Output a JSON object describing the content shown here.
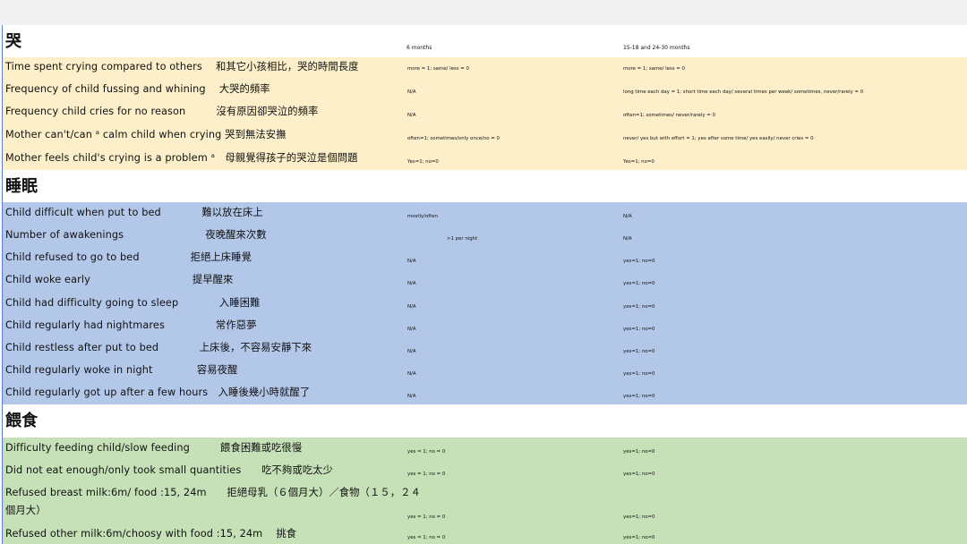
{
  "headers": {
    "col1": "6 months",
    "col2": "15-18 and 24-30 months"
  },
  "sections": {
    "crying": {
      "title": "哭",
      "rows": [
        {
          "label": "Time spent crying compared to others　 和其它小孩相比，哭的時間長度",
          "c1": "more = 1; same/ less = 0",
          "c2": "more = 1; same/ less = 0"
        },
        {
          "label": "Frequency of child fussing and whining　 大哭的頻率",
          "c1": "N/A",
          "c2": "long time each day = 1; short time each day/ several times per week/ sometimes, never/rarely = 0"
        },
        {
          "label": "Frequency child cries for no reason　　　沒有原因卻哭泣的頻率",
          "c1": "N/A",
          "c2": "often=1; sometimes/ never/rarely = 0"
        },
        {
          "label": "Mother can't/can ᵃ calm child when crying 哭到無法安撫",
          "c1": "often=1; sometimes/only once/no = 0",
          "c2": "never/ yes but with effort = 1; yes after some time/ yes easily/ never cries = 0"
        },
        {
          "label": "Mother feels child's crying is a problem ᵃ　母親覺得孩子的哭泣是個問題",
          "c1": "Yes=1; no=0",
          "c2": "Yes=1; no=0"
        }
      ]
    },
    "sleep": {
      "title": "睡眠",
      "rows": [
        {
          "label": "Child difficult when put to bed　　　　難以放在床上",
          "c1": "mostly/often",
          "c2": "N/A"
        },
        {
          "label": "Number of awakenings　　　　　　　　夜晚醒來次數",
          "c1": ">1 per night",
          "c2": "N/A"
        },
        {
          "label": "Child refused to go to bed　　　　　拒絕上床睡覺",
          "c1": "N/A",
          "c2": "yes=1; no=0"
        },
        {
          "label": "Child woke early　　　　　　　　　　提早醒來",
          "c1": "N/A",
          "c2": "yes=1; no=0"
        },
        {
          "label": "Child had difficulty going to sleep　　　　入睡困難",
          "c1": "N/A",
          "c2": "yes=1; no=0"
        },
        {
          "label": "Child regularly had nightmares　　　　　常作惡夢",
          "c1": "N/A",
          "c2": "yes=1; no=0"
        },
        {
          "label": "Child restless after put to bed　　　　上床後，不容易安靜下來",
          "c1": "N/A",
          "c2": "yes=1; no=0"
        },
        {
          "label": "Child regularly woke in night　　　　 容易夜醒",
          "c1": "N/A",
          "c2": "yes=1; no=0"
        },
        {
          "label": "Child regularly got up after a few hours　入睡後幾小時就醒了",
          "c1": "N/A",
          "c2": "yes=1; no=0"
        }
      ]
    },
    "feeding": {
      "title": "餵食",
      "rows": [
        {
          "label": "Difficulty feeding child/slow feeding　　　餵食困難或吃很慢",
          "c1": "yes = 1; no = 0",
          "c2": "yes=1; no=0"
        },
        {
          "label": "Did not eat enough/only took small quantities　　吃不夠或吃太少",
          "c1": "yes = 1; no = 0",
          "c2": "yes=1; no=0"
        },
        {
          "label": "Refused breast milk:6m/ food :15, 24m　　拒絕母乳（６個月大）／食物（１５，２４個月大）",
          "c1": "yes = 1; no = 0",
          "c2": "yes=1; no=0"
        },
        {
          "label": "Refused other milk:6m/choosy with food :15, 24m　 挑食",
          "c1": "yes = 1; no = 0",
          "c2": "yes=1; no=0"
        }
      ]
    }
  }
}
